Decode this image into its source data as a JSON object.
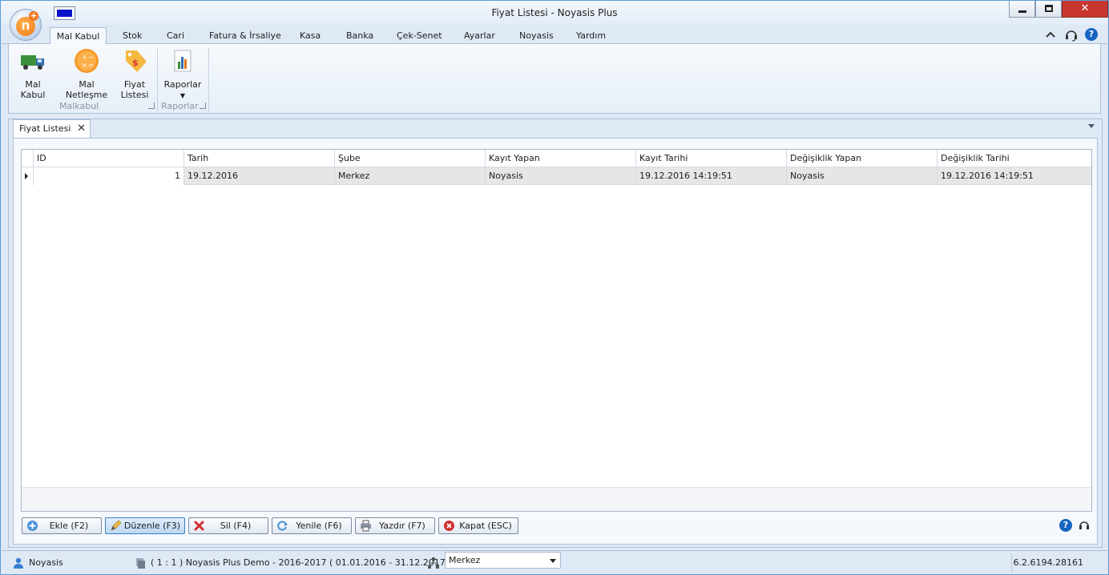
{
  "window": {
    "title": "Fiyat Listesi - Noyasis Plus"
  },
  "ribbon_tabs": [
    {
      "label": "Mal Kabul",
      "active": true
    },
    {
      "label": "Stok"
    },
    {
      "label": "Cari"
    },
    {
      "label": "Fatura & İrsaliye"
    },
    {
      "label": "Kasa"
    },
    {
      "label": "Banka"
    },
    {
      "label": "Çek-Senet"
    },
    {
      "label": "Ayarlar"
    },
    {
      "label": "Noyasis"
    },
    {
      "label": "Yardım"
    }
  ],
  "ribbon": {
    "groups": [
      {
        "label": "Malkabul",
        "buttons": [
          "Mal Kabul",
          "Mal Netleşme",
          "Fiyat Listesi"
        ]
      },
      {
        "label": "Raporlar",
        "buttons": [
          "Raporlar"
        ]
      }
    ],
    "btn_mal_kabul": "Mal Kabul",
    "btn_mal_netlesme": "Mal Netleşme",
    "btn_fiyat_listesi_1": "Fiyat",
    "btn_fiyat_listesi_2": "Listesi",
    "btn_raporlar": "Raporlar",
    "group_malkabul": "Malkabul",
    "group_raporlar": "Raporlar"
  },
  "doc_tab": {
    "label": "Fiyat Listesi"
  },
  "grid": {
    "columns": [
      "ID",
      "Tarih",
      "Şube",
      "Kayıt Yapan",
      "Kayıt Tarihi",
      "Değişiklik Yapan",
      "Değişiklik Tarihi"
    ],
    "rows": [
      [
        "1",
        "19.12.2016",
        "Merkez",
        "Noyasis",
        "19.12.2016 14:19:51",
        "Noyasis",
        "19.12.2016 14:19:51"
      ]
    ]
  },
  "actions": {
    "add": "Ekle (F2)",
    "edit": "Düzenle (F3)",
    "delete": "Sil (F4)",
    "refresh": "Yenile (F6)",
    "print": "Yazdır (F7)",
    "close": "Kapat (ESC)"
  },
  "statusbar": {
    "user": "Noyasis",
    "database": "( 1 : 1 )  Noyasis Plus Demo - 2016-2017  ( 01.01.2016 - 31.12.2017 )",
    "branch": "Merkez",
    "version": "6.2.6194.28161"
  },
  "colors": {
    "accent": "#5a9bd6",
    "help": "#1565c0",
    "delete": "#d32f2f",
    "close_button": "#c7372f"
  },
  "icons": [
    "truck-icon",
    "calculator-icon",
    "price-tag-icon",
    "report-chart-icon",
    "collapse-ribbon-icon",
    "support-headset-icon",
    "help-icon",
    "add-icon",
    "edit-icon",
    "delete-icon",
    "refresh-icon",
    "print-icon",
    "close-circle-icon",
    "user-icon",
    "database-icon",
    "branch-icon"
  ]
}
